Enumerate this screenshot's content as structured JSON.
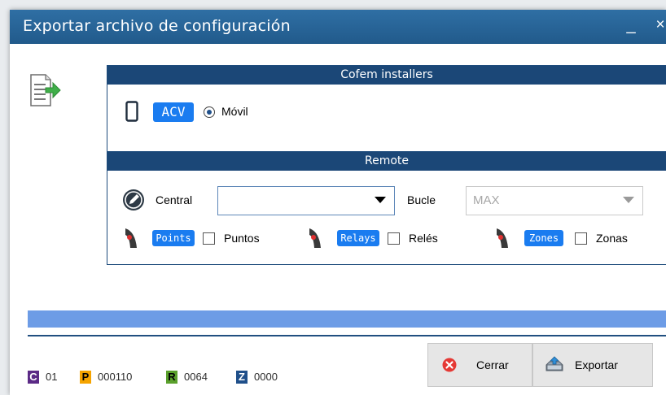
{
  "window": {
    "title": "Exportar archivo de configuración",
    "minimize_label": "_",
    "close_label": "×"
  },
  "cofem": {
    "header": "Cofem installers",
    "badge": "ACV",
    "radio_label": "Móvil",
    "radio_selected": true
  },
  "remote": {
    "header": "Remote",
    "central_label": "Central",
    "central_value": "",
    "bucle_label": "Bucle",
    "bucle_value": "MAX",
    "points_badge": "Points",
    "points_label": "Puntos",
    "relays_badge": "Relays",
    "relays_label": "Relés",
    "zones_badge": "Zones",
    "zones_label": "Zonas"
  },
  "status": {
    "items": [
      {
        "letter": "C",
        "value": "01",
        "color": "#5b2a86",
        "text_color": "#ffffff"
      },
      {
        "letter": "P",
        "value": "000110",
        "color": "#f5a400",
        "text_color": "#000000"
      },
      {
        "letter": "R",
        "value": "0064",
        "color": "#5aa02c",
        "text_color": "#000000"
      },
      {
        "letter": "Z",
        "value": "0000",
        "color": "#1f4f8a",
        "text_color": "#ffffff"
      }
    ]
  },
  "buttons": {
    "close_label": "Cerrar",
    "export_label": "Exportar"
  },
  "colors": {
    "title_bar": "#2a669b",
    "panel_header": "#1b4777",
    "badge_blue": "#1a7cf0",
    "progress": "#6d9ce6"
  }
}
